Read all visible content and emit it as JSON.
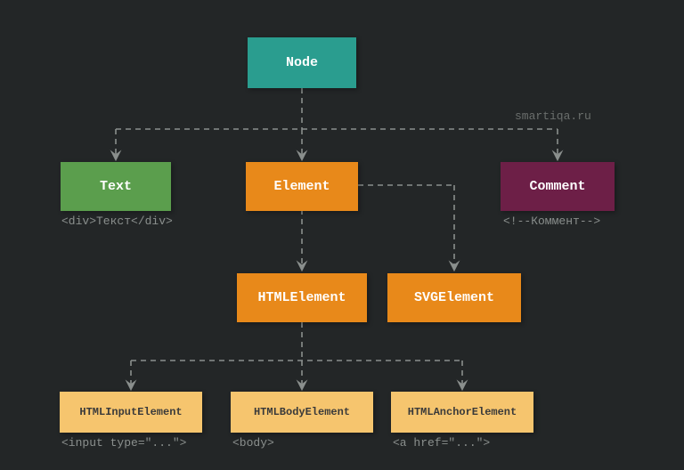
{
  "watermark": "smartiqa.ru",
  "nodes": {
    "node": "Node",
    "text": "Text",
    "element": "Element",
    "comment": "Comment",
    "htmlelement": "HTMLElement",
    "svgelement": "SVGElement",
    "htmlinput": "HTMLInputElement",
    "htmlbody": "HTMLBodyElement",
    "htmlanchor": "HTMLAnchorElement"
  },
  "captions": {
    "text": "<div>Текст</div>",
    "comment": "<!--Коммент-->",
    "input": "<input type=\"...\">",
    "body": "<body>",
    "anchor": "<a href=\"...\">"
  },
  "colors": {
    "teal": "#2a9d8f",
    "green": "#5b9e4d",
    "orange": "#e8891a",
    "maroon": "#6d1f47",
    "lightorange": "#f6c56e",
    "background": "#232627",
    "caption": "#8a8f8d",
    "arrow": "#8a8f8d"
  },
  "hierarchy": {
    "Node": [
      "Text",
      "Element",
      "Comment"
    ],
    "Element": [
      "HTMLElement",
      "SVGElement"
    ],
    "HTMLElement": [
      "HTMLInputElement",
      "HTMLBodyElement",
      "HTMLAnchorElement"
    ]
  }
}
